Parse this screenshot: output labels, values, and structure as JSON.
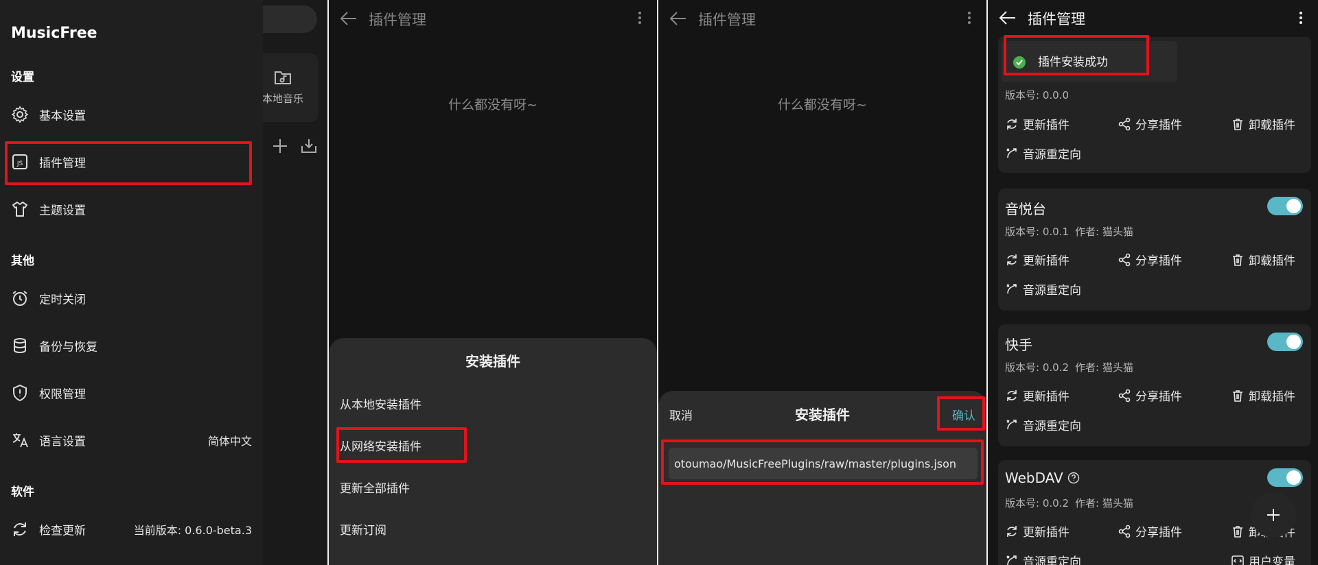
{
  "drawer": {
    "app_name": "MusicFree",
    "section_settings": "设置",
    "item_basic": "基本设置",
    "item_plugins": "插件管理",
    "item_theme": "主题设置",
    "section_other": "其他",
    "item_timer": "定时关闭",
    "item_backup": "备份与恢复",
    "item_permission": "权限管理",
    "item_language": "语言设置",
    "language_value": "简体中文",
    "section_software": "软件",
    "item_update": "检查更新",
    "version_value": "当前版本: 0.6.0-beta.3"
  },
  "behind": {
    "local_music": "本地音乐"
  },
  "panel2": {
    "title": "插件管理",
    "empty_text": "什么都没有呀~",
    "sheet_title": "安装插件",
    "opt_local": "从本地安装插件",
    "opt_network": "从网络安装插件",
    "opt_update_all": "更新全部插件",
    "opt_subscribe": "更新订阅"
  },
  "panel3": {
    "title": "插件管理",
    "empty_text": "什么都没有呀~",
    "cancel": "取消",
    "dialog_title": "安装插件",
    "confirm": "确认",
    "url_value": "otoumao/MusicFreePlugins/raw/master/plugins.json"
  },
  "panel4": {
    "title": "插件管理",
    "toast": "插件安装成功",
    "update_label": "更新插件",
    "share_label": "分享插件",
    "uninstall_label": "卸载插件",
    "redirect_label": "音源重定向",
    "user_var_label": "用户变量",
    "first_version": "版本号: 0.0.0",
    "plugins": [
      {
        "name": "音悦台",
        "version": "版本号: 0.0.1",
        "author": "作者: 猫头猫"
      },
      {
        "name": "快手",
        "version": "版本号: 0.0.2",
        "author": "作者: 猫头猫"
      },
      {
        "name": "WebDAV",
        "version": "版本号: 0.0.2",
        "author": "作者: 猫头猫"
      }
    ]
  },
  "colors": {
    "accent": "#59b7c6",
    "highlight": "#e3121b",
    "success": "#4caf50"
  }
}
